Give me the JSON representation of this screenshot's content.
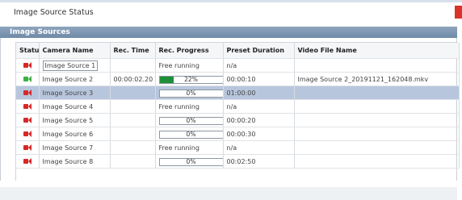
{
  "window": {
    "title": "Image Source Status"
  },
  "section": {
    "title": "Image Sources"
  },
  "table": {
    "headers": [
      "Status",
      "Camera Name",
      "Rec. Time",
      "Rec. Progress",
      "Preset Duration",
      "Video File Name"
    ],
    "rows": [
      {
        "status": "stopped",
        "camera": "Image Source 1",
        "rec_time": "",
        "progress_text": "Free running",
        "progress_pct": null,
        "preset": "n/a",
        "file": ""
      },
      {
        "status": "recording",
        "camera": "Image Source 2",
        "rec_time": "00:00:02.20",
        "progress_text": "22%",
        "progress_pct": 22,
        "preset": "00:00:10",
        "file": "Image Source 2_20191121_162048.mkv"
      },
      {
        "status": "stopped",
        "camera": "Image Source 3",
        "rec_time": "",
        "progress_text": "0%",
        "progress_pct": 0,
        "preset": "01:00:00",
        "file": ""
      },
      {
        "status": "stopped",
        "camera": "Image Source 4",
        "rec_time": "",
        "progress_text": "Free running",
        "progress_pct": null,
        "preset": "n/a",
        "file": ""
      },
      {
        "status": "stopped",
        "camera": "Image Source 5",
        "rec_time": "",
        "progress_text": "0%",
        "progress_pct": 0,
        "preset": "00:00:20",
        "file": ""
      },
      {
        "status": "stopped",
        "camera": "Image Source 6",
        "rec_time": "",
        "progress_text": "0%",
        "progress_pct": 0,
        "preset": "00:00:30",
        "file": ""
      },
      {
        "status": "stopped",
        "camera": "Image Source 7",
        "rec_time": "",
        "progress_text": "Free running",
        "progress_pct": null,
        "preset": "n/a",
        "file": ""
      },
      {
        "status": "stopped",
        "camera": "Image Source 8",
        "rec_time": "",
        "progress_text": "0%",
        "progress_pct": 0,
        "preset": "00:02:50",
        "file": ""
      }
    ]
  },
  "colors": {
    "recording": "#3cb043",
    "stopped": "#d62828",
    "header_bar": "#7a93b0",
    "selected_row": "#b8c6dd",
    "progress_fill": "#1f8f3a"
  },
  "icons": {
    "status": "camera-icon",
    "close": "close-icon"
  }
}
